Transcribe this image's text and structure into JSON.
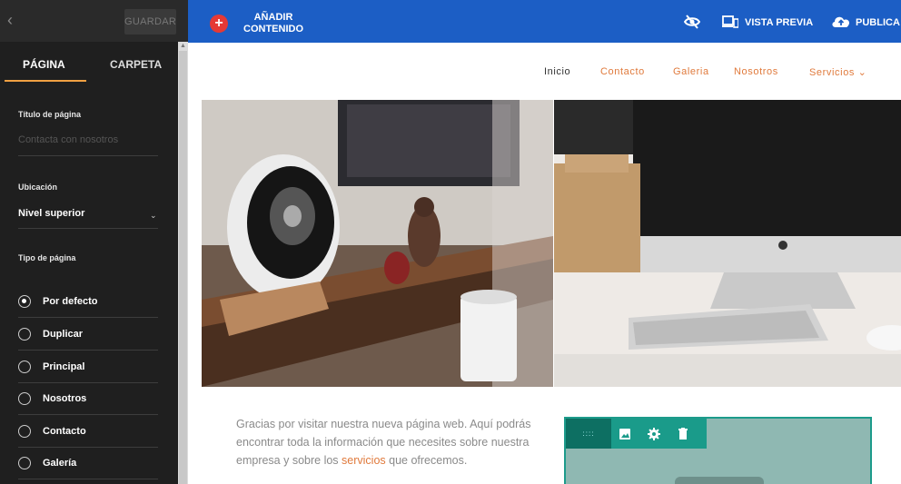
{
  "sidebar": {
    "save_label": "GUARDAR",
    "tabs": {
      "page": "PÁGINA",
      "folder": "CARPETA"
    },
    "title_label": "Título de página",
    "title_placeholder": "Contacta con nosotros",
    "location_label": "Ubicación",
    "location_value": "Nivel superior",
    "page_type_label": "Tipo de página",
    "page_types": [
      {
        "label": "Por defecto",
        "selected": true
      },
      {
        "label": "Duplicar",
        "selected": false
      },
      {
        "label": "Principal",
        "selected": false
      },
      {
        "label": "Nosotros",
        "selected": false
      },
      {
        "label": "Contacto",
        "selected": false
      },
      {
        "label": "Galería",
        "selected": false
      }
    ]
  },
  "topbar": {
    "add_label_1": "AÑADIR",
    "add_label_2": "CONTENIDO",
    "preview_label": "VISTA PREVIA",
    "publish_label": "PUBLICA"
  },
  "site_nav": [
    {
      "label": "Inicio"
    },
    {
      "label": "Contacto"
    },
    {
      "label": "Galeria"
    },
    {
      "label": "Nosotros"
    },
    {
      "label": "Servicios ⌄"
    }
  ],
  "content": {
    "intro_before": "Gracias por visitar nuestra nueva página web. Aquí podrás encontrar toda la información que necesites sobre nuestra empresa y sobre los ",
    "intro_link": "servicios",
    "intro_after": " que ofrecemos."
  },
  "colors": {
    "topbar": "#1c5ec5",
    "accent": "#e07a3c",
    "tab_underline": "#f0a042",
    "widget": "#1a9b8a"
  }
}
